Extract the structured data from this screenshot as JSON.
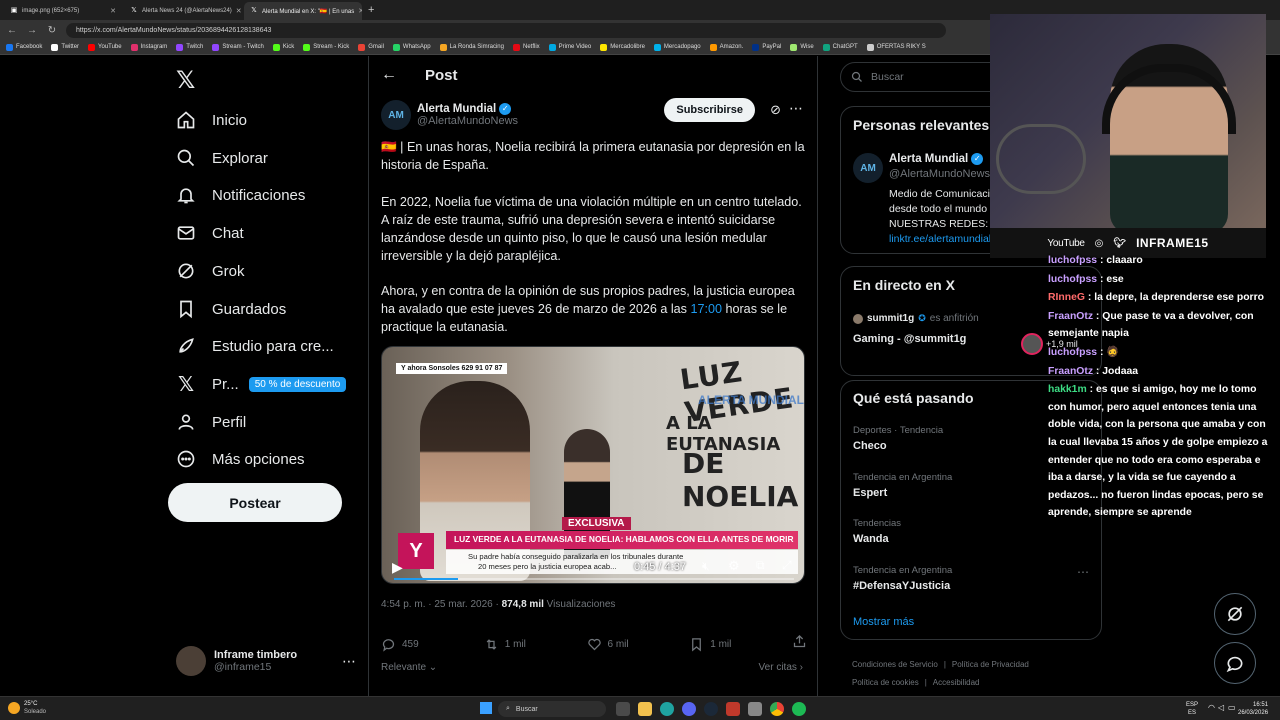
{
  "browser": {
    "tabs": [
      {
        "title": "image.png (652×675)",
        "active": false
      },
      {
        "title": "Alerta News 24 (@AlertaNews24)",
        "active": false
      },
      {
        "title": "Alerta Mundial en X: \"🇪🇸 | En unas",
        "active": true
      }
    ],
    "url": "https://x.com/AlertaMundoNews/status/2036894426128138643",
    "bookmarks": [
      {
        "label": "Facebook",
        "color": "#1877f2"
      },
      {
        "label": "Twitter",
        "color": "#ffffff"
      },
      {
        "label": "YouTube",
        "color": "#ff0000"
      },
      {
        "label": "Instagram",
        "color": "#e1306c"
      },
      {
        "label": "Twitch",
        "color": "#9146ff"
      },
      {
        "label": "Stream - Twitch",
        "color": "#9146ff"
      },
      {
        "label": "Kick",
        "color": "#53fc18"
      },
      {
        "label": "Stream - Kick",
        "color": "#53fc18"
      },
      {
        "label": "Gmail",
        "color": "#ea4335"
      },
      {
        "label": "WhatsApp",
        "color": "#25d366"
      },
      {
        "label": "La Ronda Simracing",
        "color": "#f5a623"
      },
      {
        "label": "Netflix",
        "color": "#e50914"
      },
      {
        "label": "Prime Video",
        "color": "#00a8e1"
      },
      {
        "label": "Mercadolibre",
        "color": "#ffe600"
      },
      {
        "label": "Mercadopago",
        "color": "#00b1ea"
      },
      {
        "label": "Amazon.",
        "color": "#ff9900"
      },
      {
        "label": "PayPal",
        "color": "#003087"
      },
      {
        "label": "Wise",
        "color": "#9fe870"
      },
      {
        "label": "ChatGPT",
        "color": "#10a37f"
      },
      {
        "label": "OFERTAS RIKY S",
        "color": "#cccccc"
      }
    ]
  },
  "nav": {
    "items": [
      {
        "label": "Inicio",
        "icon": "home-icon"
      },
      {
        "label": "Explorar",
        "icon": "search-icon"
      },
      {
        "label": "Notificaciones",
        "icon": "bell-icon"
      },
      {
        "label": "Chat",
        "icon": "mail-icon"
      },
      {
        "label": "Grok",
        "icon": "grok-icon"
      },
      {
        "label": "Guardados",
        "icon": "bookmark-icon"
      },
      {
        "label": "Estudio para cre...",
        "icon": "rocket-icon"
      },
      {
        "label": "Pr...",
        "icon": "x-premium-icon"
      },
      {
        "label": "Perfil",
        "icon": "person-icon"
      },
      {
        "label": "Más opciones",
        "icon": "more-icon"
      }
    ],
    "premium_badge": "50 % de descuento",
    "post_button": "Postear",
    "account": {
      "name": "Inframe timbero",
      "handle": "@inframe15"
    }
  },
  "post": {
    "header_title": "Post",
    "author_name": "Alerta Mundial",
    "author_handle": "@AlertaMundoNews",
    "subscribe": "Subscribirse",
    "paragraph1": "🇪🇸 | En unas horas, Noelia recibirá la primera eutanasia por depresión en la historia de España.",
    "paragraph2": "En 2022, Noelia fue víctima de una violación múltiple en un centro tutelado. A raíz de este trauma, sufrió una depresión severa e intentó suicidarse lanzándose desde un quinto piso, lo que le causó una lesión medular irreversible y la dejó parapléjica.",
    "paragraph3_before": "Ahora, y en contra de la opinión de sus propios padres, la justicia europea ha avalado que este jueves 26 de marzo de 2026 a las ",
    "paragraph3_link": "17:00",
    "paragraph3_after": " horas se le practique la eutanasia.",
    "video": {
      "wall_text_1": "LUZ VERDE",
      "wall_text_2": "A LA EUTANASIA",
      "wall_text_3": "DE NOELIA",
      "watermark": "ALERTA MUNDIAL",
      "phone_banner": "Y ahora Sonsoles  629 91 07 87",
      "exclusive": "EXCLUSIVA",
      "headline": "LUZ VERDE A LA EUTANASIA DE NOELIA: HABLAMOS CON ELLA ANTES DE MORIR",
      "subtitle_1": "Su padre había conseguido paralizarla en los tribunales durante",
      "subtitle_2": "20 meses pero la justicia europea acab...",
      "time": "0:45 / 4:37",
      "progress": 0.16
    },
    "timestamp": "4:54 p. m. · 25 mar. 2026 · ",
    "views_count": "874,8 mil",
    "views_label": " Visualizaciones",
    "replies": "459",
    "reposts": "1 mil",
    "likes": "6 mil",
    "bookmarks": "1 mil",
    "relevance": "Relevante",
    "quotes": "Ver citas"
  },
  "sidebar": {
    "search_placeholder": "Buscar",
    "relevant_title": "Personas relevantes",
    "relevant_name": "Alerta Mundial",
    "relevant_handle": "@AlertaMundoNews",
    "relevant_bio_1": "Medio de Comunicación",
    "relevant_bio_2": "desde todo el mundo",
    "relevant_bio_3": "NUESTRAS REDES:",
    "relevant_link": "linktr.ee/alertamundial",
    "live_title": "En directo en X",
    "live_host": "summit1g",
    "live_host_suffix": "es anfitrión",
    "live_stream": "Gaming - @summit1g",
    "live_viewers": "+1,9 mil",
    "trends_title": "Qué está pasando",
    "trends": [
      {
        "category": "Deportes · Tendencia",
        "name": "Checo"
      },
      {
        "category": "Tendencia en Argentina",
        "name": "Espert"
      },
      {
        "category": "Tendencias",
        "name": "Wanda"
      },
      {
        "category": "Tendencia en Argentina",
        "name": "#DefensaYJusticia"
      }
    ],
    "show_more": "Mostrar más",
    "footer": [
      "Condiciones de Servicio",
      "|",
      "Política de Privacidad",
      "|",
      "Política de cookies",
      "|",
      "Accesibilidad"
    ]
  },
  "webcam": {
    "youtube": "YouTube",
    "handle": "INFRAME15"
  },
  "chat": [
    {
      "user": "luchofpss",
      "color": "#c9a0ff",
      "msg": "claaaro"
    },
    {
      "user": "luchofpss",
      "color": "#c9a0ff",
      "msg": "ese"
    },
    {
      "user": "RInneG",
      "color": "#ff6b6b",
      "msg": "la depre, la deprenderse ese porro"
    },
    {
      "user": "FraanOtz",
      "color": "#c9a0ff",
      "msg": "Que pase te va a devolver, con semejante napia"
    },
    {
      "user": "luchofpss",
      "color": "#c9a0ff",
      "msg": "🧔"
    },
    {
      "user": "FraanOtz",
      "color": "#c9a0ff",
      "msg": "Jodaaa"
    },
    {
      "user": "hakk1m",
      "color": "#3ddc84",
      "msg": "es que si amigo, hoy me lo tomo con humor, pero aquel entonces tenia una doble vida, con la persona que amaba y con la cual llevaba 15 años y de golpe empiezo a entender que no todo era como esperaba e iba a darse, y la vida se fue cayendo a pedazos... no fueron lindas epocas, pero se aprende, siempre se aprende"
    }
  ],
  "taskbar": {
    "weather_temp": "25°C",
    "weather_desc": "Soleado",
    "search": "Buscar",
    "lang1": "ESP",
    "lang2": "ES",
    "time": "16:51",
    "date": "26/03/2026"
  }
}
